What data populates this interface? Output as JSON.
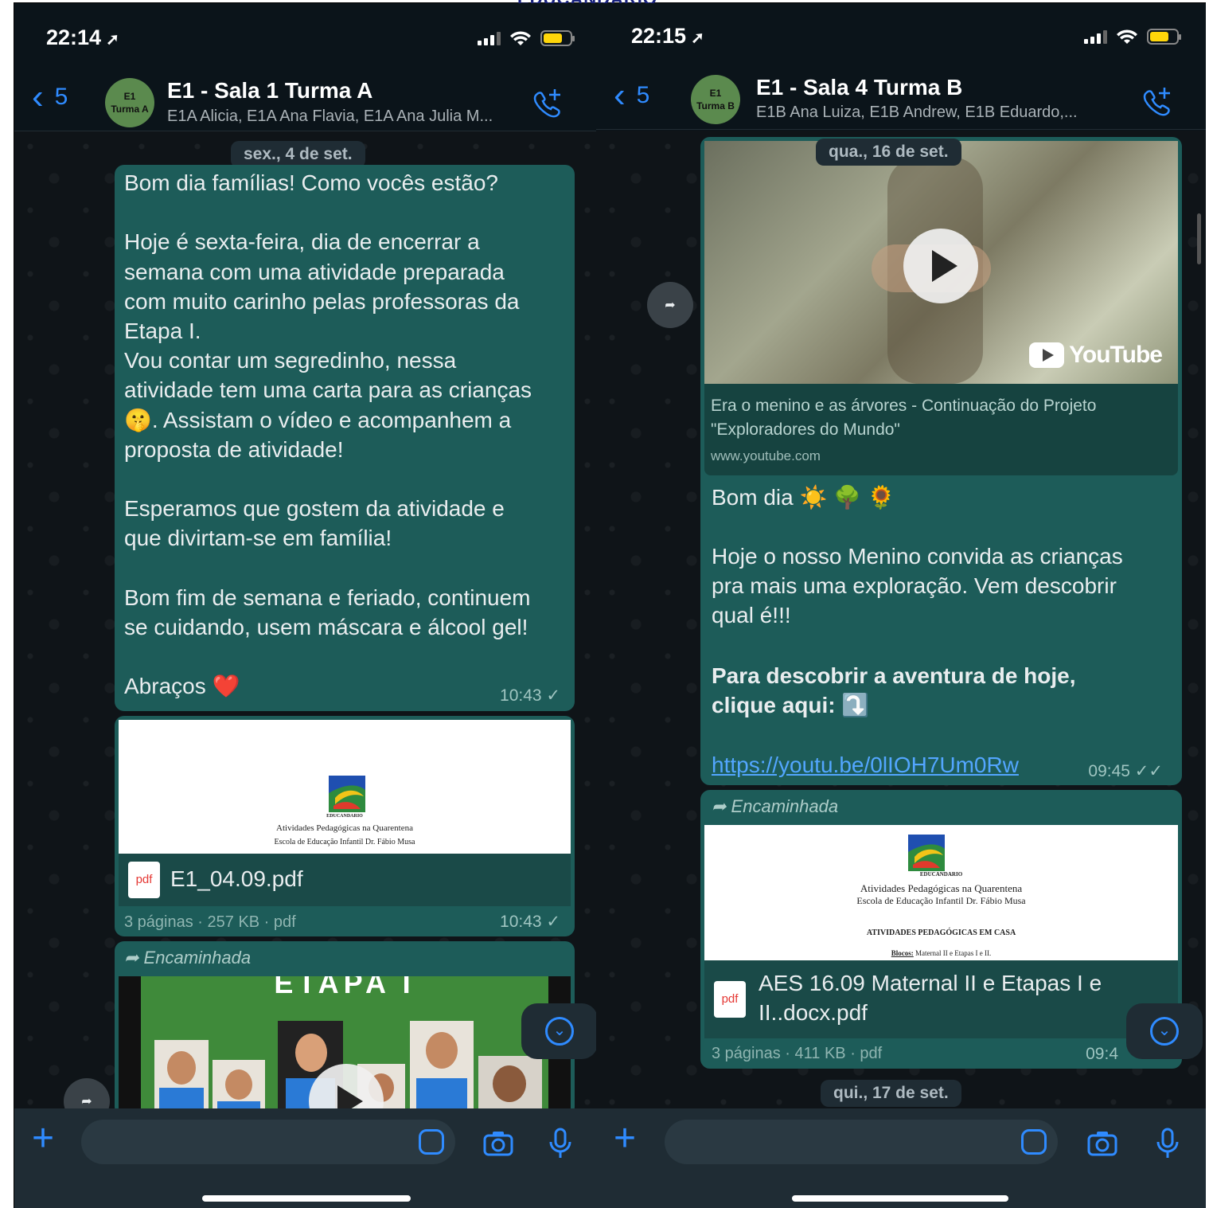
{
  "left": {
    "status": {
      "time": "22:14",
      "loc": "➚"
    },
    "header": {
      "back_count": "5",
      "avatar_line1": "E1",
      "avatar_line2": "Turma A",
      "title": "E1 - Sala 1 Turma A",
      "subtitle": "E1A Alicia, E1A Ana Flavia, E1A Ana Julia M..."
    },
    "date": "sex., 4 de set.",
    "message": {
      "text": "Bom dia famílias! Como vocês estão?\n\nHoje é sexta-feira, dia de encerrar a\nsemana com uma atividade preparada\ncom muito carinho pelas professoras da\nEtapa I.\nVou contar um segredinho, nessa\natividade tem uma carta para as crianças\n🤫. Assistam o vídeo e acompanhem a\nproposta de atividade!\n\nEsperamos que gostem da atividade e\nque divirtam-se em família!\n\nBom fim de semana e feriado, continuem\nse cuidando, usem máscara e álcool gel!\n\nAbraços ❤️",
      "time": "10:43 ✓"
    },
    "file": {
      "logo_text": "EDUCANDARIO",
      "doc_line1": "Atividades Pedagógicas na Quarentena",
      "doc_line2": "Escola de Educação Infantil Dr. Fábio Musa",
      "icon_label": "pdf",
      "name": "E1_04.09.pdf",
      "meta": "3 páginas · 257 KB · pdf",
      "time": "10:43 ✓"
    },
    "forwarded": {
      "label": "Encaminhada",
      "video_title": "ETAPA I"
    }
  },
  "right": {
    "status": {
      "time": "22:15",
      "loc": "➚"
    },
    "header": {
      "back_count": "5",
      "avatar_line1": "E1",
      "avatar_line2": "Turma B",
      "title": "E1 - Sala 4 Turma B",
      "subtitle": "E1B Ana Luiza, E1B Andrew, E1B Eduardo,..."
    },
    "date": "qua., 16 de set.",
    "link_preview": {
      "brand": "YouTube",
      "title": "Era o menino e as árvores - Continuação do Projeto \"Exploradores do Mundo\"",
      "domain": "www.youtube.com"
    },
    "message": {
      "greeting": "Bom dia ☀️ 🌳 🌻",
      "body": "Hoje o nosso Menino convida as crianças\npra mais uma exploração. Vem descobrir\nqual é!!!",
      "bold": "Para descobrir a aventura de hoje,\nclique aqui: ⤵️",
      "link": "https://youtu.be/0lIOH7Um0Rw",
      "time": "09:45 ✓✓"
    },
    "file": {
      "forwarded_label": "Encaminhada",
      "logo_text": "EDUCANDARIO",
      "doc_line1": "Atividades Pedagógicas na Quarentena",
      "doc_line2": "Escola de Educação Infantil Dr. Fábio Musa",
      "doc_line3": "ATIVIDADES PEDAGÓGICAS EM CASA",
      "doc_line4_bold": "Blocos:",
      "doc_line4": " Maternal II e Etapas I e II.",
      "icon_label": "pdf",
      "name": "AES 16.09 Maternal II e Etapas I e\nII..docx.pdf",
      "meta": "3 páginas · 411 KB · pdf",
      "time": "09:4"
    },
    "next_date": "qui., 17 de set."
  },
  "colors": {
    "accent": "#2f8bff",
    "bubble": "#1d5c59",
    "background": "#0b141a"
  }
}
